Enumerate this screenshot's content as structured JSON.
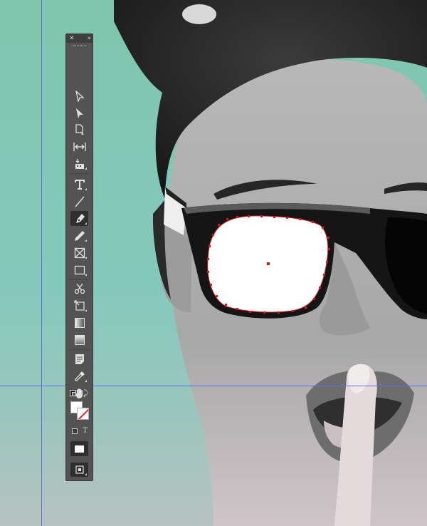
{
  "panel": {
    "name": "Tools",
    "close_icon": "close-icon",
    "collapse_icon": "double-chevron-icon",
    "active_tool": "pen-tool",
    "tools": [
      {
        "name": "selection-tool",
        "icon": "arrow-icon"
      },
      {
        "name": "direct-selection-tool",
        "icon": "filled-arrow-icon"
      },
      {
        "name": "page-tool",
        "icon": "page-icon"
      },
      {
        "name": "gap-tool",
        "icon": "gap-icon"
      },
      {
        "name": "content-collector-tool",
        "icon": "collector-icon"
      },
      {
        "name": "type-tool",
        "icon": "type-icon"
      },
      {
        "name": "line-tool",
        "icon": "line-icon"
      },
      {
        "name": "pen-tool",
        "icon": "pen-icon"
      },
      {
        "name": "pencil-tool",
        "icon": "pencil-icon"
      },
      {
        "name": "rectangle-frame-tool",
        "icon": "frame-icon"
      },
      {
        "name": "rectangle-tool",
        "icon": "rectangle-icon"
      },
      {
        "name": "scissors-tool",
        "icon": "scissors-icon"
      },
      {
        "name": "free-transform-tool",
        "icon": "transform-icon"
      },
      {
        "name": "gradient-swatch-tool",
        "icon": "gradient-icon"
      },
      {
        "name": "gradient-feather-tool",
        "icon": "feather-icon"
      },
      {
        "name": "note-tool",
        "icon": "note-icon"
      },
      {
        "name": "eyedropper-tool",
        "icon": "eyedropper-icon"
      },
      {
        "name": "hand-tool",
        "icon": "hand-icon"
      },
      {
        "name": "zoom-tool",
        "icon": "zoom-icon"
      }
    ],
    "fill_color": "#ffffff",
    "stroke_color": "#ffffff",
    "formatting_text_label": "T"
  },
  "colors": {
    "panel_bg": "#535353",
    "guide": "#5d6fe8",
    "anchor": "#e01616"
  }
}
